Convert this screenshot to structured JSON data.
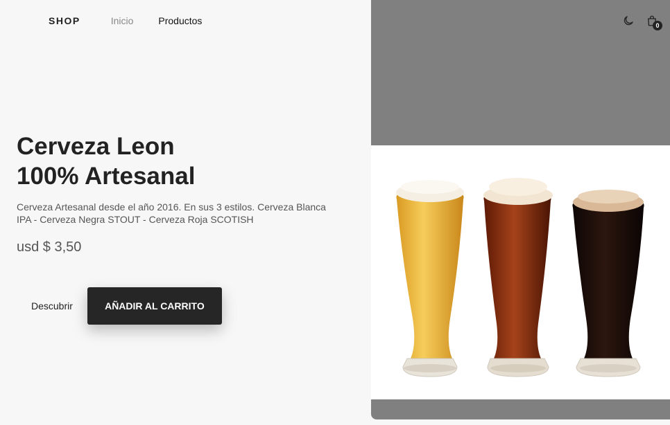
{
  "nav": {
    "brand": "SHOP",
    "links": [
      {
        "label": "Inicio",
        "active": false
      },
      {
        "label": "Productos",
        "active": true
      }
    ]
  },
  "header_icons": {
    "theme_toggle_icon": "moon-icon",
    "cart_icon": "shopping-bag-icon",
    "cart_count": "0"
  },
  "hero": {
    "title_line1": "Cerveza Leon",
    "title_line2": "100% Artesanal",
    "description": "Cerveza Artesanal desde el año 2016. En sus 3 estilos. Cerveza Blanca IPA - Cerveza Negra STOUT - Cerveza Roja SCOTISH",
    "price": "usd $ 3,50",
    "secondary_button": "Descubrir",
    "primary_button": "AÑADIR AL CARRITO"
  },
  "product_image": {
    "subject": "three glasses of beer: blonde, red, dark",
    "colors": {
      "blonde": "#e8b33a",
      "red": "#8a2e0f",
      "dark": "#1c0f0b",
      "foam": "#f3ece0"
    }
  }
}
